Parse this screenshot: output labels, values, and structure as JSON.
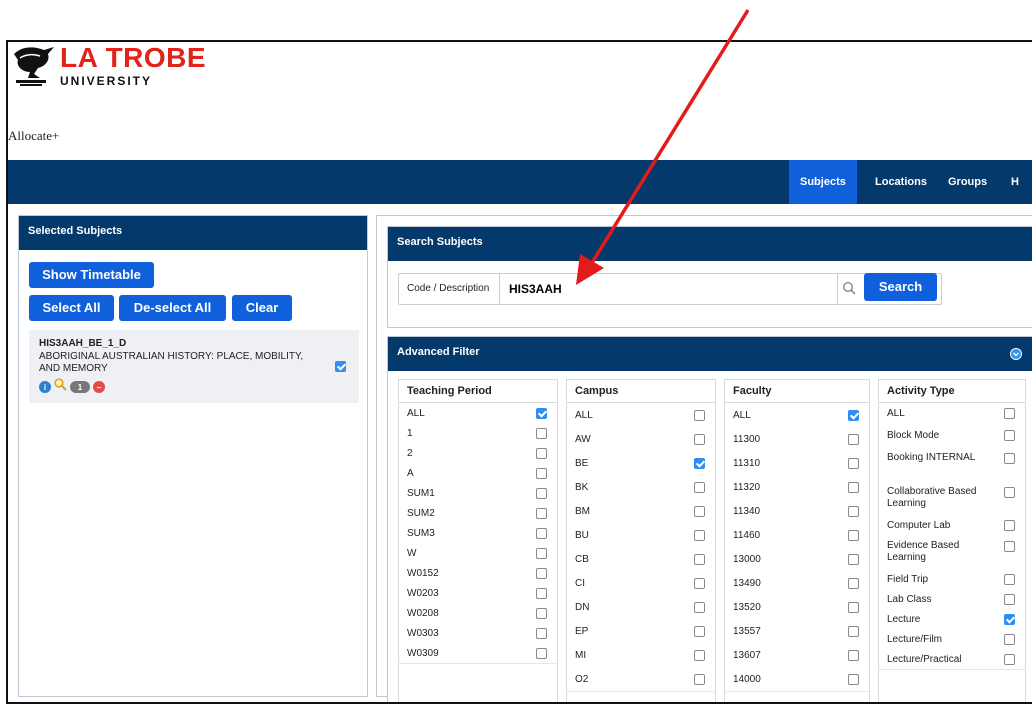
{
  "logo": {
    "line1": "LA TROBE",
    "line2": "UNIVERSITY"
  },
  "app_name": "Allocate+",
  "nav": {
    "items": [
      "Subjects",
      "Locations",
      "Groups",
      "H"
    ],
    "active": "Subjects"
  },
  "selected_panel": {
    "title": "Selected Subjects",
    "show_timetable": "Show Timetable",
    "select_all": "Select All",
    "deselect_all": "De-select All",
    "clear": "Clear",
    "subject": {
      "code": "HIS3AAH_BE_1_D",
      "description": "ABORIGINAL AUSTRALIAN HISTORY: PLACE, MOBILITY, AND MEMORY",
      "checked": true,
      "icons": [
        "info-icon",
        "magnifier-icon",
        "count-badge",
        "remove-icon"
      ],
      "count": "1"
    }
  },
  "search_panel": {
    "title": "Search Subjects",
    "field_label": "Code / Description",
    "value": "HIS3AAH",
    "button": "Search"
  },
  "advanced_filter": {
    "title": "Advanced Filter",
    "columns": [
      {
        "header": "Teaching Period",
        "items": [
          {
            "label": "ALL",
            "checked": true
          },
          {
            "label": "1",
            "checked": false
          },
          {
            "label": "2",
            "checked": false
          },
          {
            "label": "A",
            "checked": false
          },
          {
            "label": "SUM1",
            "checked": false
          },
          {
            "label": "SUM2",
            "checked": false
          },
          {
            "label": "SUM3",
            "checked": false
          },
          {
            "label": "W",
            "checked": false
          },
          {
            "label": "W0152",
            "checked": false
          },
          {
            "label": "W0203",
            "checked": false
          },
          {
            "label": "W0208",
            "checked": false
          },
          {
            "label": "W0303",
            "checked": false
          },
          {
            "label": "W0309",
            "checked": false
          }
        ]
      },
      {
        "header": "Campus",
        "items": [
          {
            "label": "ALL",
            "checked": false
          },
          {
            "label": "AW",
            "checked": false
          },
          {
            "label": "BE",
            "checked": true
          },
          {
            "label": "BK",
            "checked": false
          },
          {
            "label": "BM",
            "checked": false
          },
          {
            "label": "BU",
            "checked": false
          },
          {
            "label": "CB",
            "checked": false
          },
          {
            "label": "CI",
            "checked": false
          },
          {
            "label": "DN",
            "checked": false
          },
          {
            "label": "EP",
            "checked": false
          },
          {
            "label": "MI",
            "checked": false
          },
          {
            "label": "O2",
            "checked": false
          }
        ]
      },
      {
        "header": "Faculty",
        "items": [
          {
            "label": "ALL",
            "checked": true
          },
          {
            "label": "11300",
            "checked": false
          },
          {
            "label": "11310",
            "checked": false
          },
          {
            "label": "11320",
            "checked": false
          },
          {
            "label": "11340",
            "checked": false
          },
          {
            "label": "11460",
            "checked": false
          },
          {
            "label": "13000",
            "checked": false
          },
          {
            "label": "13490",
            "checked": false
          },
          {
            "label": "13520",
            "checked": false
          },
          {
            "label": "13557",
            "checked": false
          },
          {
            "label": "13607",
            "checked": false
          },
          {
            "label": "14000",
            "checked": false
          }
        ]
      },
      {
        "header": "Activity Type",
        "items": [
          {
            "label": "ALL",
            "checked": false
          },
          {
            "label": "Block Mode",
            "checked": false
          },
          {
            "label": "Booking INTERNAL",
            "checked": false
          },
          {
            "label": "Collaborative Based Learning",
            "checked": false
          },
          {
            "label": "Computer Lab",
            "checked": false
          },
          {
            "label": "Evidence Based Learning",
            "checked": false
          },
          {
            "label": "Field Trip",
            "checked": false
          },
          {
            "label": "Lab Class",
            "checked": false
          },
          {
            "label": "Lecture",
            "checked": true
          },
          {
            "label": "Lecture/Film",
            "checked": false
          },
          {
            "label": "Lecture/Practical",
            "checked": false
          }
        ]
      }
    ]
  },
  "colors": {
    "navy": "#03396b",
    "blue": "#1060dc",
    "red": "#e2231a",
    "check": "#2c8ff5",
    "arrow": "#e21b1b"
  }
}
